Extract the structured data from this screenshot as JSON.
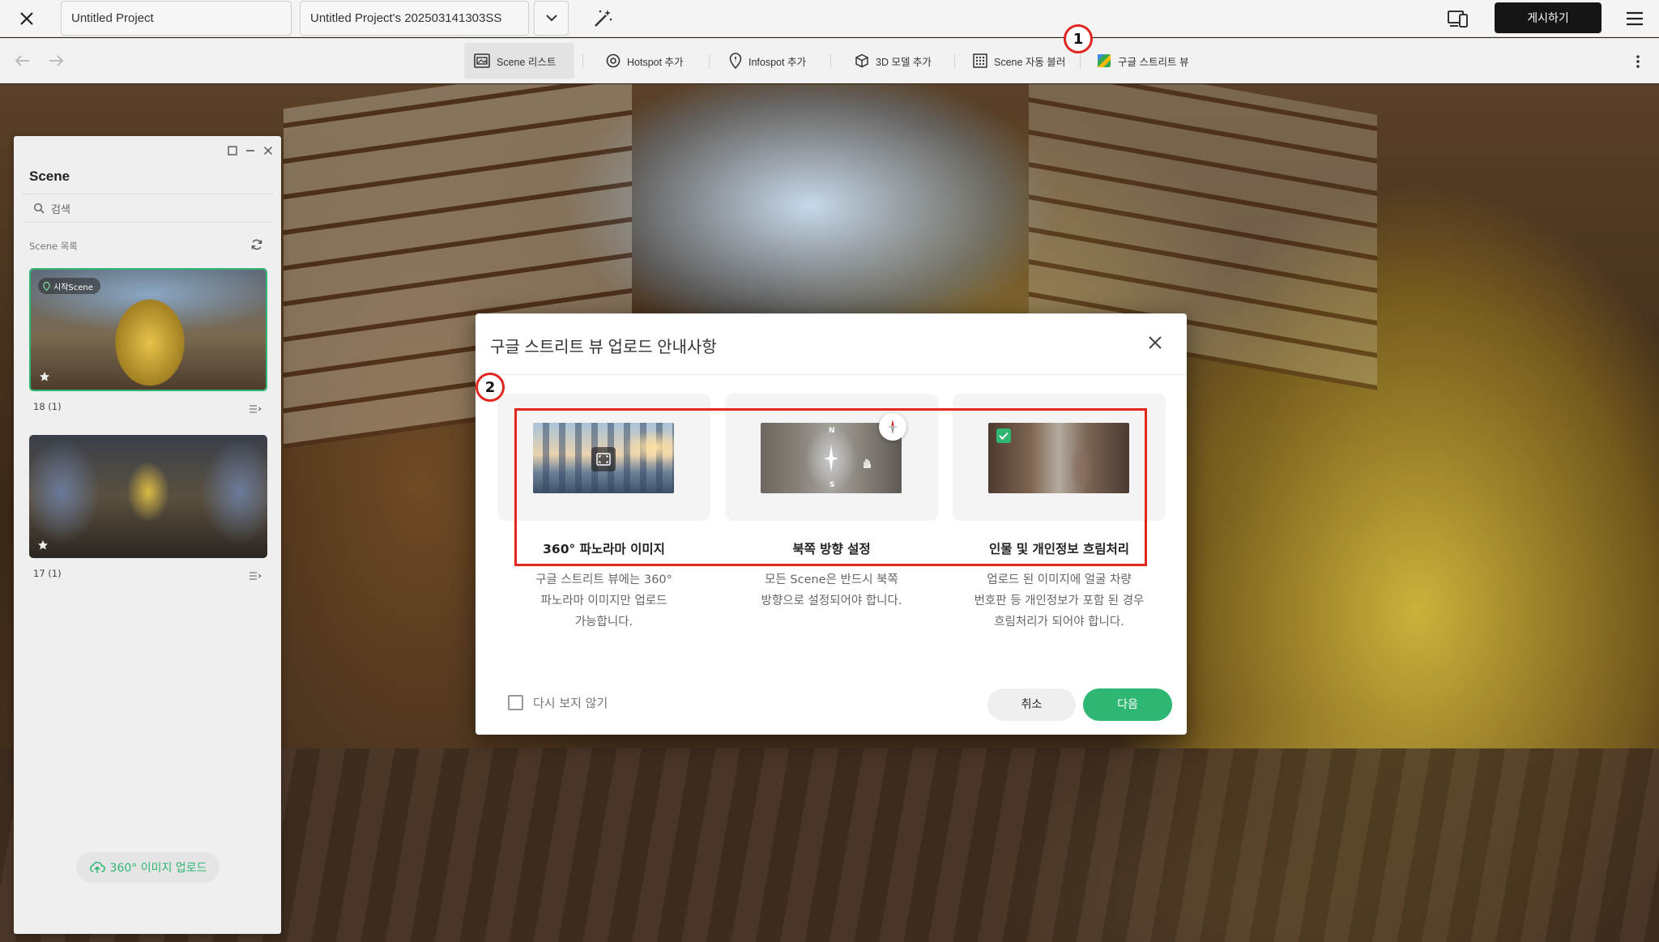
{
  "topbar": {
    "project_name": "Untitled Project",
    "version_name": "Untitled Project's 202503141303SS",
    "publish_label": "게시하기"
  },
  "toolbar": {
    "tools": [
      {
        "label": "Scene 리스트",
        "icon": "scene-list-icon"
      },
      {
        "label": "Hotspot 추가",
        "icon": "hotspot-icon"
      },
      {
        "label": "Infospot 추가",
        "icon": "infospot-icon"
      },
      {
        "label": "3D 모델 추가",
        "icon": "cube-icon"
      },
      {
        "label": "Scene 자동 블러",
        "icon": "blur-icon"
      },
      {
        "label": "구글 스트리트 뷰",
        "icon": "google-maps-icon"
      }
    ]
  },
  "panel": {
    "title": "Scene",
    "search_placeholder": "검색",
    "list_header": "Scene 목록",
    "scenes": [
      {
        "label": "18 (1)",
        "badge": "시작Scene",
        "selected": true
      },
      {
        "label": "17 (1)",
        "badge": "",
        "selected": false
      }
    ],
    "upload_label": "360° 이미지 업로드"
  },
  "modal": {
    "title": "구글 스트리트 뷰 업로드 안내사항",
    "cards": [
      {
        "title": "360° 파노라마 이미지",
        "desc": [
          "구글 스트리트 뷰에는 360°",
          "파노라마 이미지만 업로드",
          "가능합니다."
        ]
      },
      {
        "title": "북쪽 방향 설정",
        "desc": [
          "모든 Scene은 반드시 북쪽",
          "방향으로 설정되어야 합니다."
        ],
        "compass_n": "N",
        "compass_s": "S"
      },
      {
        "title": "인물 및 개인정보 흐림처리",
        "desc": [
          "업로드 된 이미지에 얼굴 차량",
          "번호판 등 개인정보가 포함 된 경우",
          "흐림처리가 되어야 합니다."
        ]
      }
    ],
    "dont_show_label": "다시 보지 않기",
    "cancel_label": "취소",
    "next_label": "다음"
  },
  "annotations": {
    "marker1": "1",
    "marker2": "2"
  },
  "colors": {
    "accent": "#2fb673",
    "highlight": "#e0261e",
    "publish_bg": "#151515"
  }
}
